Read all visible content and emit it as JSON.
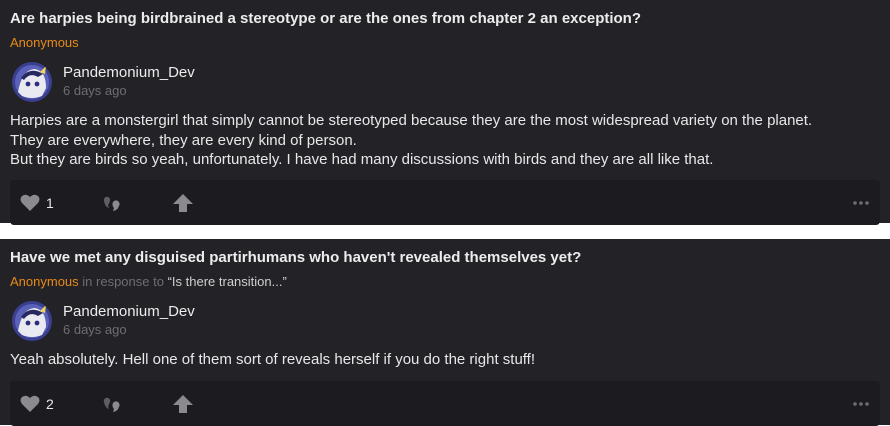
{
  "posts": [
    {
      "question": "Are harpies being birdbrained a stereotype or are the ones from chapter 2 an exception?",
      "asker": "Anonymous",
      "in_response_to": "",
      "quoted": "",
      "author": "Pandemonium_Dev",
      "time": "6 days ago",
      "answer_lines": [
        "Harpies are a monstergirl that simply cannot be stereotyped because they are the most widespread variety on the planet.",
        "They are everywhere, they are every kind of person.",
        "But they are birds so yeah, unfortunately. I have had many discussions with birds and they are all like that."
      ],
      "likes": "1"
    },
    {
      "question": "Have we met any disguised partirhumans who haven't revealed themselves yet?",
      "asker": "Anonymous",
      "in_response_to": "in response to",
      "quoted": "“Is there transition...”",
      "author": "Pandemonium_Dev",
      "time": "6 days ago",
      "answer_lines": [
        "Yeah absolutely. Hell one of them sort of reveals herself if you do the right stuff!"
      ],
      "likes": "2"
    }
  ],
  "icons": {
    "like": "heart-icon",
    "quote": "quote-icon",
    "share": "share-arrow-icon",
    "more": "more-dots-icon"
  },
  "colors": {
    "card_bg": "#232226",
    "accent": "#e88a18",
    "muted": "#6f6d73"
  }
}
